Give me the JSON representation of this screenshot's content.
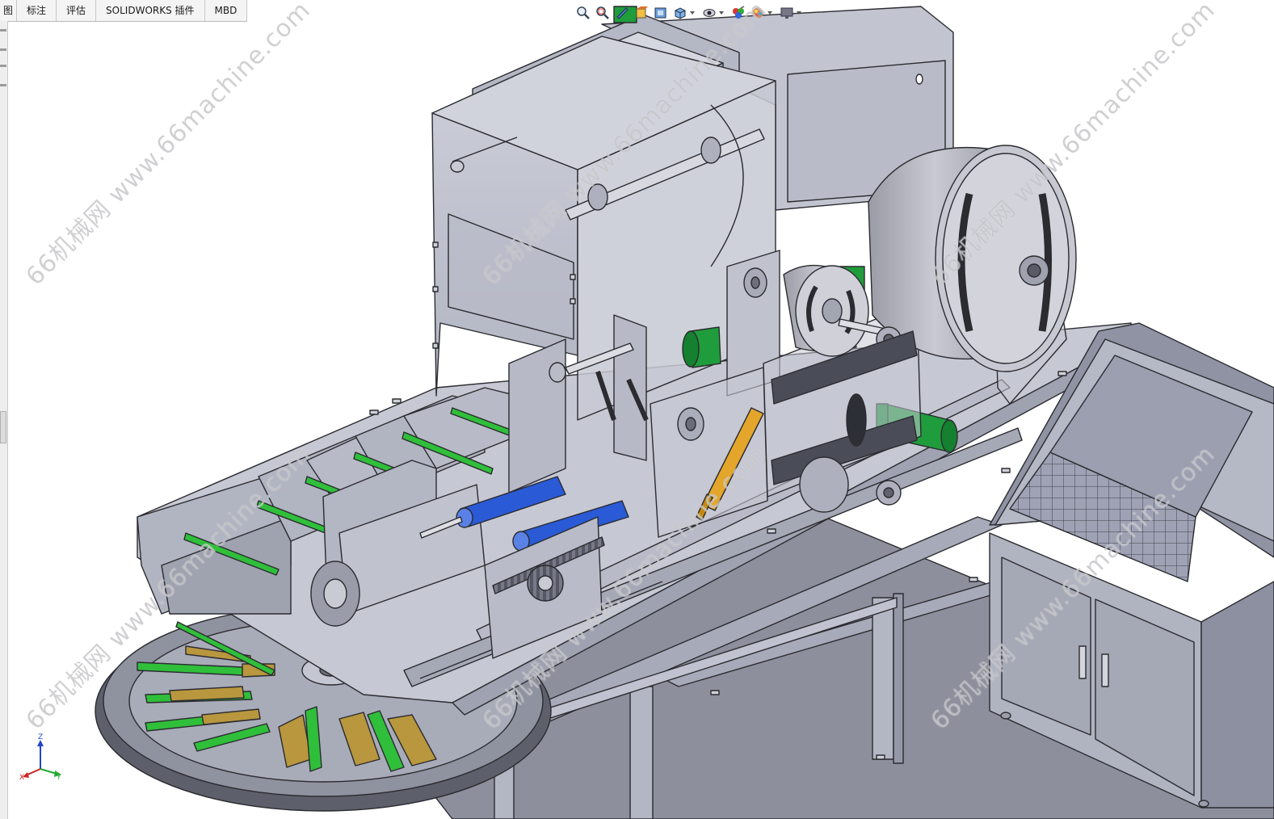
{
  "tabs": [
    {
      "label": "图"
    },
    {
      "label": "标注"
    },
    {
      "label": "评估"
    },
    {
      "label": "SOLIDWORKS 插件"
    },
    {
      "label": "MBD"
    }
  ],
  "heads_up_toolbar": [
    {
      "icon": "zoom-to-fit-icon"
    },
    {
      "icon": "zoom-to-area-icon"
    },
    {
      "icon": "previous-view-icon"
    },
    {
      "icon": "section-view-icon"
    },
    {
      "icon": "dynamic-annotation-icon"
    },
    {
      "icon": "view-orientation-icon"
    },
    {
      "icon": "display-style-icon"
    },
    {
      "icon": "hide-show-items-icon"
    },
    {
      "icon": "edit-appearance-icon"
    },
    {
      "icon": "apply-scene-icon"
    },
    {
      "icon": "view-settings-icon"
    }
  ],
  "watermark": {
    "text": "66机械网 www.66machine.com"
  },
  "triad": {
    "x_label": "X",
    "y_label": "Y",
    "z_label": "Z"
  },
  "colors": {
    "steel": "#b9bcc8",
    "steel_dark": "#8f93a3",
    "glass": "#c4c6d2",
    "motor_green": "#1f9d3c",
    "belt_green": "#2fbf3a",
    "cylinder_blue": "#2a5ad6",
    "actuator_gold": "#e3a52a",
    "brass": "#b8973e",
    "outline": "#2b2b30"
  }
}
